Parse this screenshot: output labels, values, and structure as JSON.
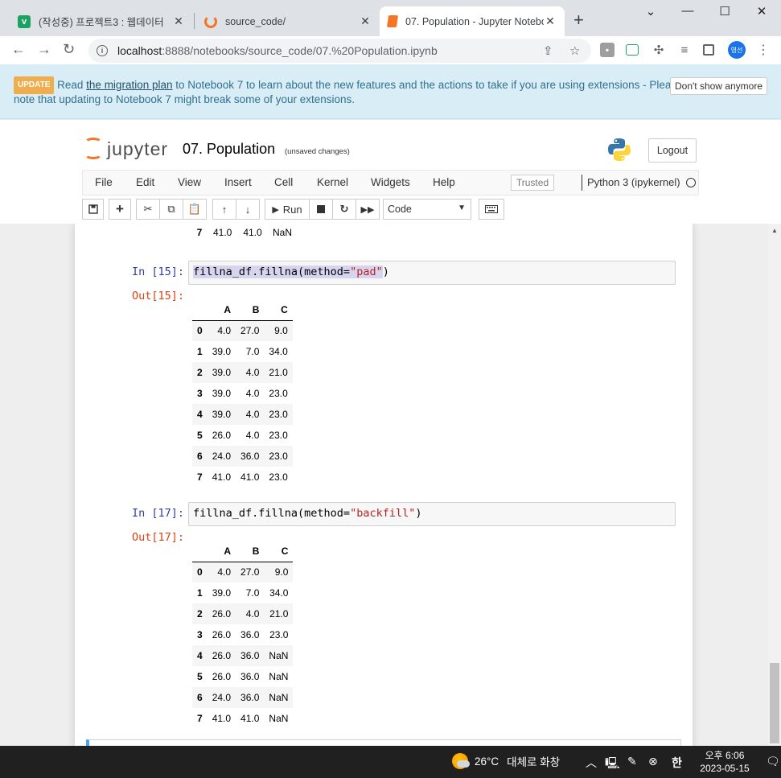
{
  "browser": {
    "tabs": [
      {
        "title": "(작성중) 프로젝트3 : 웹데이터",
        "icon": "velog-icon"
      },
      {
        "title": "source_code/",
        "icon": "jupyter-icon"
      },
      {
        "title": "07. Population - Jupyter Notebo",
        "icon": "notebook-icon"
      }
    ],
    "url_host": "localhost",
    "url_path": ":8888/notebooks/source_code/07.%20Population.ipynb",
    "profile_label": "영선"
  },
  "banner": {
    "badge": "UPDATE",
    "text_before_link": "Read ",
    "link_text": "the migration plan",
    "text_after_link": " to Notebook 7 to learn about the new features and the actions to take if you are using extensions - Please",
    "line2": "note that updating to Notebook 7 might break some of your extensions.",
    "dismiss_label": "Don't show anymore"
  },
  "jupyter": {
    "logo_text": "jupyter",
    "notebook_name": "07. Population",
    "save_status": "(unsaved changes)",
    "logout_label": "Logout",
    "menu": [
      "File",
      "Edit",
      "View",
      "Insert",
      "Cell",
      "Kernel",
      "Widgets",
      "Help"
    ],
    "trusted_label": "Trusted",
    "kernel_name": "Python 3 (ipykernel)",
    "run_label": "Run",
    "cell_type": "Code"
  },
  "notebook": {
    "partial_row": {
      "index": "7",
      "A": "41.0",
      "B": "41.0",
      "C": "NaN"
    },
    "cells": [
      {
        "in_prompt": "In [15]:",
        "code_prefix": "fillna_df.fillna(method=",
        "code_string": "\"pad\"",
        "code_suffix": ")",
        "out_prompt": "Out[15]:",
        "columns": [
          "A",
          "B",
          "C"
        ],
        "rows": [
          {
            "index": "0",
            "values": [
              "4.0",
              "27.0",
              "9.0"
            ]
          },
          {
            "index": "1",
            "values": [
              "39.0",
              "7.0",
              "34.0"
            ]
          },
          {
            "index": "2",
            "values": [
              "39.0",
              "4.0",
              "21.0"
            ]
          },
          {
            "index": "3",
            "values": [
              "39.0",
              "4.0",
              "23.0"
            ]
          },
          {
            "index": "4",
            "values": [
              "39.0",
              "4.0",
              "23.0"
            ]
          },
          {
            "index": "5",
            "values": [
              "26.0",
              "4.0",
              "23.0"
            ]
          },
          {
            "index": "6",
            "values": [
              "24.0",
              "36.0",
              "23.0"
            ]
          },
          {
            "index": "7",
            "values": [
              "41.0",
              "41.0",
              "23.0"
            ]
          }
        ]
      },
      {
        "in_prompt": "In [17]:",
        "code_prefix": "fillna_df.fillna(method=",
        "code_string": "\"backfill\"",
        "code_suffix": ")",
        "out_prompt": "Out[17]:",
        "columns": [
          "A",
          "B",
          "C"
        ],
        "rows": [
          {
            "index": "0",
            "values": [
              "4.0",
              "27.0",
              "9.0"
            ]
          },
          {
            "index": "1",
            "values": [
              "39.0",
              "7.0",
              "34.0"
            ]
          },
          {
            "index": "2",
            "values": [
              "26.0",
              "4.0",
              "21.0"
            ]
          },
          {
            "index": "3",
            "values": [
              "26.0",
              "36.0",
              "23.0"
            ]
          },
          {
            "index": "4",
            "values": [
              "26.0",
              "36.0",
              "NaN"
            ]
          },
          {
            "index": "5",
            "values": [
              "26.0",
              "36.0",
              "NaN"
            ]
          },
          {
            "index": "6",
            "values": [
              "24.0",
              "36.0",
              "NaN"
            ]
          },
          {
            "index": "7",
            "values": [
              "41.0",
              "41.0",
              "NaN"
            ]
          }
        ]
      }
    ]
  },
  "taskbar": {
    "weather_temp": "26°C",
    "weather_desc": "대체로 화창",
    "ime": "한",
    "time": "오후 6:06",
    "date": "2023-05-15"
  }
}
